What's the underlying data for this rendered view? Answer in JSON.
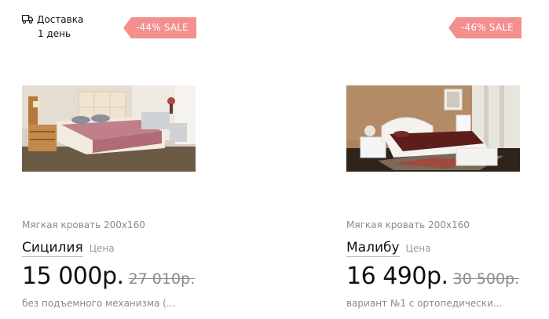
{
  "products": [
    {
      "delivery": {
        "line1": "Доставка",
        "line2": "1 день",
        "icon": "truck-icon"
      },
      "sale": "-44% SALE",
      "subtitle": "Мягкая кровать 200x160",
      "name": "Сицилия",
      "price_label": "Цена",
      "price": "15 000р.",
      "old_price": "27 010р.",
      "description": "без подъемного механизма (..."
    },
    {
      "sale": "-46% SALE",
      "subtitle": "Мягкая кровать 200x160",
      "name": "Малибу",
      "price_label": "Цена",
      "price": "16 490р.",
      "old_price": "30 500р.",
      "description": "вариант №1 с ортопедически..."
    }
  ],
  "colors": {
    "sale_badge": "#f48f8f",
    "text": "#111111",
    "muted": "#8a8a8a"
  }
}
